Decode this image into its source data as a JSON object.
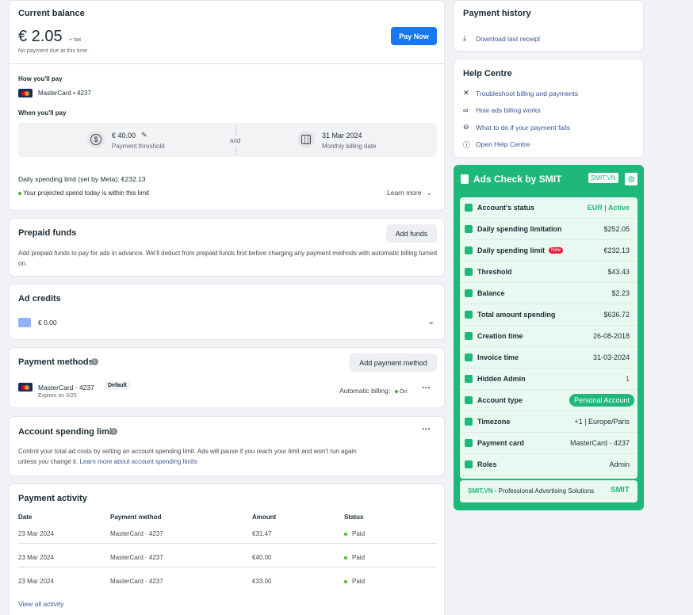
{
  "balance": {
    "title": "Current balance",
    "amount": "€ 2.05",
    "tax": "+ tax",
    "note": "No payment due at this time.",
    "pay_now": "Pay Now",
    "how_label": "How you'll pay",
    "card": "MasterCard • 4237",
    "when_label": "When you'll pay",
    "threshold_value": "€ 40.00",
    "threshold_label": "Payment threshold",
    "and": "and",
    "date_value": "31 Mar 2024",
    "date_label": "Monthly billing date",
    "daily_limit": "Daily spending limit (set by Meta): €232.13",
    "projected": "Your projected spend today is within this limit",
    "learn_more": "Learn more"
  },
  "prepaid": {
    "title": "Prepaid funds",
    "button": "Add funds",
    "desc": "Add prepaid funds to pay for ads in advance. We'll deduct from prepaid funds first before charging any payment methods with automatic billing turned on."
  },
  "credits": {
    "title": "Ad credits",
    "amount": "€ 0.00"
  },
  "methods": {
    "title": "Payment methods",
    "button": "Add payment method",
    "card": "MasterCard · 4237",
    "badge": "Default",
    "expires": "Expires on 3/25",
    "auto_billing": "Automatic billing:",
    "auto_state": "On"
  },
  "limit": {
    "title": "Account spending limit",
    "desc1": "Control your total ad costs by setting an account spending limit. Ads will pause if you reach your limit and won't run again",
    "desc2": "unless you change it.",
    "desc_link": "Learn more about account spending limits"
  },
  "activity": {
    "title": "Payment activity",
    "headers": [
      "Date",
      "Payment method",
      "Amount",
      "Status"
    ],
    "rows": [
      [
        "23 Mar 2024",
        "MasterCard · 4237",
        "€31.47",
        "Paid"
      ],
      [
        "23 Mar 2024",
        "MasterCard · 4237",
        "€40.00",
        "Paid"
      ],
      [
        "23 Mar 2024",
        "MasterCard · 4237",
        "€33.00",
        "Paid"
      ]
    ],
    "view_all": "View all activity"
  },
  "history": {
    "title": "Payment history",
    "download": "Download last receipt"
  },
  "help": {
    "title": "Help Centre",
    "items": [
      "Troubleshoot billing and payments",
      "How ads billing works",
      "What to do if your payment fails",
      "Open Help Centre"
    ]
  },
  "smit": {
    "title": "Ads Check by SMIT",
    "tag": "SMIT.VN",
    "rows": [
      {
        "label": "Account's status",
        "value": "EUR | Active"
      },
      {
        "label": "Daily spending limitation",
        "value": "$252.05"
      },
      {
        "label": "Daily spending limit",
        "value": "€232.13",
        "badge": "New"
      },
      {
        "label": "Threshold",
        "value": "$43.43"
      },
      {
        "label": "Balance",
        "value": "$2.23"
      },
      {
        "label": "Total amount spending",
        "value": "$636.72"
      },
      {
        "label": "Creation time",
        "value": "26-08-2018"
      },
      {
        "label": "Invoice time",
        "value": "31-03-2024"
      },
      {
        "label": "Hidden Admin",
        "value": "1"
      },
      {
        "label": "Account type",
        "value": "Personal Account"
      },
      {
        "label": "Timezone",
        "value": "+1 | Europe/Paris"
      },
      {
        "label": "Payment card",
        "value": "MasterCard · 4237"
      },
      {
        "label": "Roles",
        "value": "Admin"
      }
    ],
    "footer_brand": "SMIT.VN",
    "footer_text": " - Professional Advertising Solutions",
    "logo": "SMIT"
  },
  "colors": {
    "primary": "#1877f2",
    "smit_green": "#1fb87b",
    "paid": "#42b72a"
  }
}
